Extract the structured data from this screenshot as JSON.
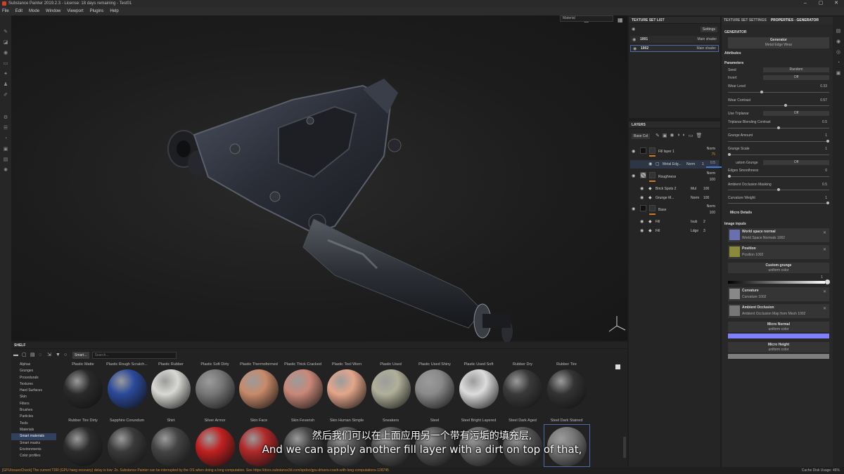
{
  "window": {
    "title": "Substance Painter 2019.2.3 - License: 18 days remaining - Test01",
    "minimize": "–",
    "maximize": "▢",
    "close": "✕"
  },
  "menu": [
    "File",
    "Edit",
    "Mode",
    "Window",
    "Viewport",
    "Plugins",
    "Help"
  ],
  "viewport": {
    "material_select": "Material"
  },
  "texture_set_list": {
    "title": "TEXTURE SET LIST",
    "settings": "Settings",
    "rows": [
      {
        "name": "1001",
        "shader": "Main shader"
      },
      {
        "name": "1002",
        "shader": "Main shader"
      }
    ]
  },
  "layers": {
    "title": "LAYERS",
    "channel": "Base Col",
    "rows": [
      {
        "name": "Fill layer 1",
        "blend": "Norm",
        "opacity": "75"
      },
      {
        "name": "Metal Edg...",
        "blend": "Norm",
        "opacity": "1"
      },
      {
        "name": "Roughness",
        "blend": "Norm",
        "opacity": "100"
      },
      {
        "name": "Brick Spots 2",
        "blend": "Mul",
        "opacity": "100"
      },
      {
        "name": "Grunge M...",
        "blend": "Norm",
        "opacity": "100"
      },
      {
        "name": "Base",
        "blend": "Norm",
        "opacity": "100"
      },
      {
        "name": "Fill",
        "blend": "Isub",
        "opacity": "2"
      },
      {
        "name": "Fill",
        "blend": "Ldge",
        "opacity": "3"
      }
    ],
    "drag_value": "0.5"
  },
  "properties": {
    "tab_settings": "TEXTURE SET SETTINGS",
    "tab_props": "PROPERTIES - GENERATOR",
    "section_generator": "GENERATOR",
    "generator_label": "Generator",
    "generator_value": "Metal Edge Wear",
    "attributes": "Attributes",
    "parameters": "Parameters",
    "seed_label": "Seed",
    "seed_value": "Random",
    "invert_label": "Invert",
    "invert_value": "Off",
    "wear_level_label": "Wear Level",
    "wear_level_value": "0.33",
    "wear_level": 0.33,
    "wear_contrast_label": "Wear Contrast",
    "wear_contrast_value": "0.57",
    "wear_contrast": 0.57,
    "triplanar_label": "Use Triplanar",
    "triplanar_value": "Off",
    "tri_blend_label": "Triplanar Blending Contrast",
    "tri_blend_value": "0.5",
    "tri_blend": 0.5,
    "grunge_amount_label": "Grunge Amount",
    "grunge_amount_value": "1",
    "grunge_amount": 1,
    "grunge_scale_label": "Grunge Scale",
    "grunge_scale_value": "1",
    "grunge_scale": 0,
    "custom_grunge_label": "ustom Grunge",
    "custom_grunge_value": "Off",
    "edges_smooth_label": "Edges Smoothness",
    "edges_smooth_value": "0",
    "edges_smooth": 0,
    "ao_mask_label": "Ambient Occlusion Masking",
    "ao_mask_value": "0.5",
    "ao_mask": 0.5,
    "curv_weight_label": "Curvature Weight",
    "curv_weight_value": "1",
    "curv_weight": 1,
    "micro_details": "Micro Details",
    "image_inputs": "Image inputs",
    "inputs": [
      {
        "title": "World space normal",
        "value": "World Space Normals 1002",
        "color": "#6a6fb0"
      },
      {
        "title": "Position",
        "value": "Position 1002",
        "color": "#8a8a3a"
      }
    ],
    "custom_grunge": {
      "title": "Custom grunge",
      "value": "uniform color"
    },
    "grunge_slider_value": "1",
    "inputs2": [
      {
        "title": "Curvature",
        "value": "Curvature 1002",
        "color": "#888888"
      },
      {
        "title": "Ambient Occlusion",
        "value": "Ambient Occlusion Map from Mesh 1002",
        "color": "#777777"
      }
    ],
    "micro_normal": {
      "title": "Micro Normal",
      "value": "uniform color",
      "color": "#8080ff"
    },
    "micro_height": {
      "title": "Micro Height",
      "value": "uniform color",
      "color": "#7f7f7f"
    }
  },
  "shelf": {
    "title": "SHELF",
    "filter": "Smart...",
    "search_placeholder": "Search...",
    "categories": [
      "Alphas",
      "Grunges",
      "Procedurals",
      "Textures",
      "Hard Surfaces",
      "Skin",
      "Filters",
      "Brushes",
      "Particles",
      "Tools",
      "Materials",
      "Smart materials",
      "Smart masks",
      "Environments",
      "Color profiles"
    ],
    "selected_category": "Smart materials",
    "row1": [
      {
        "name": "Plastic Matte",
        "color": "#2a2a2a"
      },
      {
        "name": "Plastic Rough Scratch...",
        "color": "#2b4a9a"
      },
      {
        "name": "Plastic Rubber",
        "color": "#d8d8d4"
      },
      {
        "name": "Plastic Soft Dirty",
        "color": "#777777"
      },
      {
        "name": "Plastic Thermoformed",
        "color": "#c88a6a"
      },
      {
        "name": "Plastic Thick Cracked",
        "color": "#c98878"
      },
      {
        "name": "Plastic Tool Worn",
        "color": "#e4a68a"
      },
      {
        "name": "Plastic Used",
        "color": "#b0b09a"
      },
      {
        "name": "Plastic Used Shiny",
        "color": "#8a8a8a"
      },
      {
        "name": "Plastic Used Soft",
        "color": "#dcdcdc"
      },
      {
        "name": "Rubber Dry",
        "color": "#3a3a3a"
      },
      {
        "name": "Rubber Tire",
        "color": "#333333"
      }
    ],
    "row2": [
      {
        "name": "Rubber Tire Dirty",
        "color": "#2c2c2c"
      },
      {
        "name": "Sapphire Corundum",
        "color": "#3a3a3a"
      },
      {
        "name": "Shirt",
        "color": "#444444"
      },
      {
        "name": "Silver Armor",
        "color": "#c02020"
      },
      {
        "name": "Skin Face",
        "color": "#b02828"
      },
      {
        "name": "Skin Feverish",
        "color": "#444444"
      },
      {
        "name": "Skin Human Simple",
        "color": "#555555"
      },
      {
        "name": "Sneakers",
        "color": "#555555"
      },
      {
        "name": "Steel",
        "color": "#555555"
      },
      {
        "name": "Steel Bright Layered",
        "color": "#666666"
      },
      {
        "name": "Steel Dark Aged",
        "color": "#555555"
      },
      {
        "name": "Steel Dark Stained",
        "color": "#777777"
      }
    ]
  },
  "subtitles": {
    "zh": "然后我们可以在上面应用另一个带有污垢的填充层,",
    "en": "And we can apply another fill layer with a dirt on top of that,"
  },
  "status": {
    "message": "[GPUIssuesCheck] The current TDR (GPU hang recovery) delay is low: 2s. Substance Painter can be interrupted by the OS when doing a long computation. See https://docs.substance3d.com/spdoc/gpu-drivers-crash-with-long-computations-128745",
    "cache": "Cache Disk Usage:",
    "cache_value": "46%"
  }
}
